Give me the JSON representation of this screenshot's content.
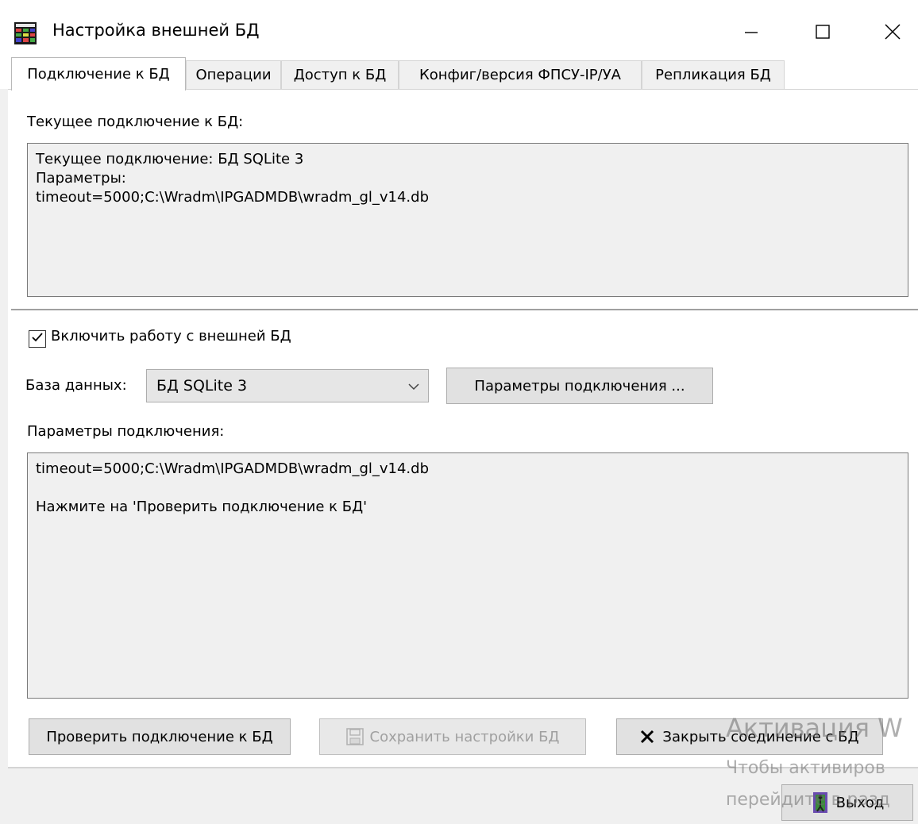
{
  "window": {
    "title": "Настройка внешней БД",
    "icons": {
      "app": "database-grid-icon",
      "minimize": "minimize-icon",
      "maximize": "maximize-icon",
      "close": "close-icon"
    }
  },
  "tabs": [
    {
      "label": "Подключение к БД",
      "active": true
    },
    {
      "label": "Операции",
      "active": false
    },
    {
      "label": "Доступ к БД",
      "active": false
    },
    {
      "label": "Конфиг/версия ФПСУ-IP/УА",
      "active": false
    },
    {
      "label": "Репликация БД",
      "active": false
    }
  ],
  "current": {
    "label": "Текущее подключение к БД:",
    "text": "Текущее подключение: БД SQLite 3\nПараметры:\ntimeout=5000;C:\\Wradm\\IPGADMDB\\wradm_gl_v14.db"
  },
  "enable_external": {
    "label": "Включить работу с внешней БД",
    "checked": true
  },
  "database": {
    "label": "База данных:",
    "selected": "БД SQLite 3"
  },
  "params_button": "Параметры подключения ...",
  "params": {
    "label": "Параметры подключения:",
    "text": "timeout=5000;C:\\Wradm\\IPGADMDB\\wradm_gl_v14.db\n\nНажмите на 'Проверить подключение к БД'"
  },
  "buttons": {
    "check": "Проверить подключение к БД",
    "save": "Сохранить настройки БД",
    "save_enabled": false,
    "close_conn": "Закрыть соединение с БД",
    "exit": "Выход"
  },
  "watermark": {
    "line1": "Активация W",
    "line2": "Чтобы активиров",
    "line3": "перейдите в разд"
  },
  "colors": {
    "window_bg": "#f0f0f0",
    "client_bg": "#ffffff",
    "textbox_bg": "#f0f0f0",
    "button_bg": "#e1e1e1"
  }
}
